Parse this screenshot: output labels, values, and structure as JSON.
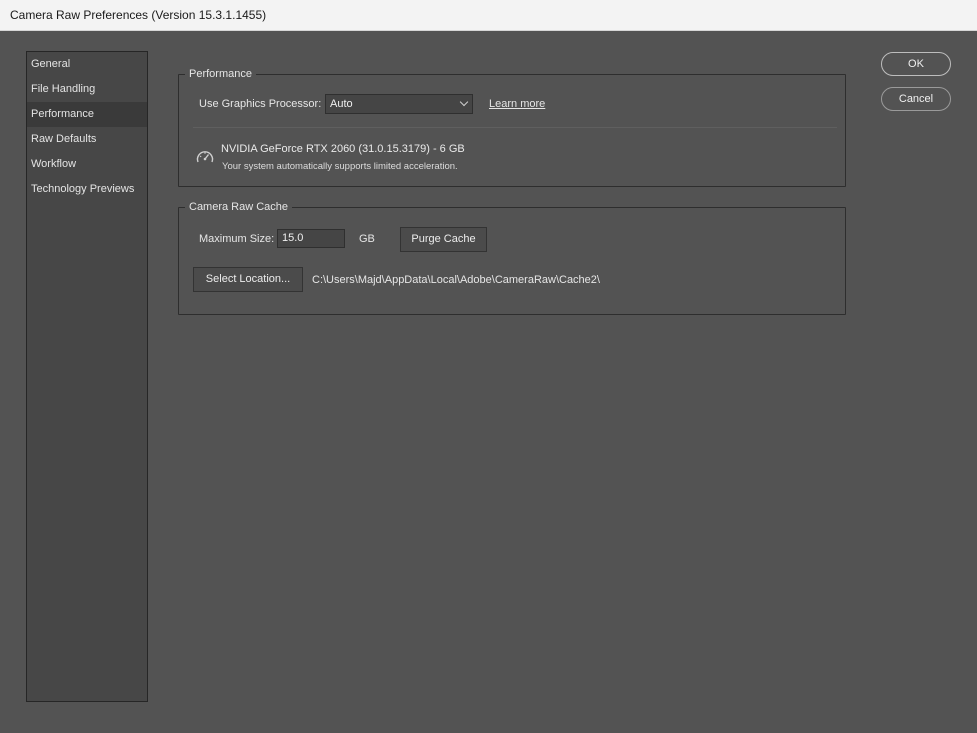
{
  "window": {
    "title": "Camera Raw Preferences  (Version 15.3.1.1455)"
  },
  "sidebar": {
    "items": [
      {
        "label": "General"
      },
      {
        "label": "File Handling"
      },
      {
        "label": "Performance",
        "selected": true
      },
      {
        "label": "Raw Defaults"
      },
      {
        "label": "Workflow"
      },
      {
        "label": "Technology Previews"
      }
    ]
  },
  "performance": {
    "title": "Performance",
    "gpu_label": "Use Graphics Processor:",
    "gpu_select_value": "Auto",
    "learn_more": "Learn more",
    "gpu_icon": "speedometer-icon",
    "gpu_name": "NVIDIA GeForce RTX 2060 (31.0.15.3179) - 6 GB",
    "gpu_note": "Your system automatically supports limited acceleration."
  },
  "cache": {
    "title": "Camera Raw Cache",
    "max_size_label": "Maximum Size:",
    "max_size_value": "15.0",
    "unit": "GB",
    "purge_label": "Purge Cache",
    "select_location_label": "Select Location...",
    "location_path": "C:\\Users\\Majd\\AppData\\Local\\Adobe\\CameraRaw\\Cache2\\"
  },
  "actions": {
    "ok_label": "OK",
    "cancel_label": "Cancel"
  }
}
